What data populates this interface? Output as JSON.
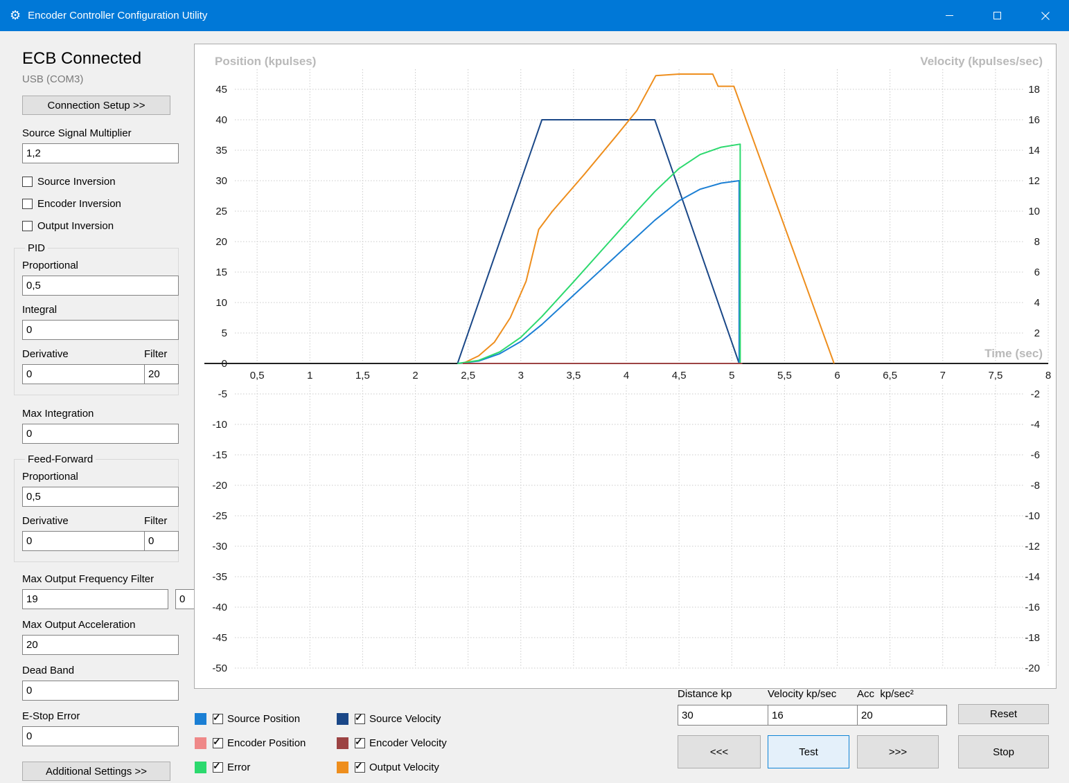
{
  "window": {
    "title": "Encoder Controller Configuration Utility"
  },
  "sidebar": {
    "status_heading": "ECB Connected",
    "port": "USB (COM3)",
    "connection_setup_label": "Connection Setup >>",
    "source_signal_multiplier": {
      "label": "Source Signal Multiplier",
      "value": "1,2"
    },
    "checkboxes": [
      {
        "label": "Source Inversion",
        "checked": false
      },
      {
        "label": "Encoder Inversion",
        "checked": false
      },
      {
        "label": "Output Inversion",
        "checked": false
      }
    ],
    "pid": {
      "group_label": "PID",
      "proportional_label": "Proportional",
      "proportional_value": "0,5",
      "integral_label": "Integral",
      "integral_value": "0",
      "derivative_label": "Derivative",
      "derivative_value": "0",
      "filter_label": "Filter",
      "filter_value": "20"
    },
    "max_integration": {
      "label": "Max Integration",
      "value": "0"
    },
    "feed_forward": {
      "group_label": "Feed-Forward",
      "proportional_label": "Proportional",
      "proportional_value": "0,5",
      "derivative_label": "Derivative",
      "derivative_value": "0",
      "filter_label": "Filter",
      "filter_value": "0"
    },
    "max_output_frequency_filter": {
      "label": "Max Output Frequency Filter",
      "value": "19",
      "aux_value": "0"
    },
    "max_output_acceleration": {
      "label": "Max Output Acceleration",
      "value": "20"
    },
    "dead_band": {
      "label": "Dead Band",
      "value": "0"
    },
    "e_stop_error": {
      "label": "E-Stop Error",
      "value": "0"
    },
    "additional_settings_label": "Additional Settings >>"
  },
  "chart_data": {
    "type": "line",
    "grid": true,
    "x_axis": {
      "label": "Time (sec)",
      "min": 0,
      "max": 8,
      "tick_step": 0.5
    },
    "left_axis": {
      "label": "Position (kpulses)",
      "min": -50,
      "max": 45,
      "tick_step": 5
    },
    "right_axis": {
      "label": "Velocity (kpulses/sec)",
      "min": -20,
      "max": 18,
      "tick_step": 2
    },
    "series": [
      {
        "name": "Encoder Position",
        "axis": "left",
        "color": "#ef8888",
        "points": [
          [
            2.4,
            0
          ],
          [
            5.1,
            0
          ]
        ]
      },
      {
        "name": "Source Velocity",
        "axis": "right",
        "color": "#1a4787",
        "points": [
          [
            2.4,
            0
          ],
          [
            3.2,
            16
          ],
          [
            4.27,
            16
          ],
          [
            5.07,
            0
          ]
        ]
      },
      {
        "name": "Output Velocity",
        "axis": "right",
        "color": "#ee8e1d",
        "points": [
          [
            2.45,
            0
          ],
          [
            2.6,
            0.5
          ],
          [
            2.75,
            1.4
          ],
          [
            2.9,
            3.0
          ],
          [
            3.05,
            5.4
          ],
          [
            3.17,
            8.8
          ],
          [
            3.3,
            10.0
          ],
          [
            3.6,
            12.4
          ],
          [
            3.9,
            14.9
          ],
          [
            4.1,
            16.6
          ],
          [
            4.28,
            18.9
          ],
          [
            4.5,
            19
          ],
          [
            4.82,
            19
          ],
          [
            4.87,
            18.2
          ],
          [
            5.02,
            18.2
          ],
          [
            5.97,
            0
          ]
        ]
      },
      {
        "name": "Source Position",
        "axis": "left",
        "color": "#1b7fd4",
        "points": [
          [
            2.4,
            0
          ],
          [
            2.6,
            0.4
          ],
          [
            2.8,
            1.6
          ],
          [
            3.0,
            3.6
          ],
          [
            3.2,
            6.4
          ],
          [
            3.5,
            11.2
          ],
          [
            3.8,
            16
          ],
          [
            4.1,
            20.8
          ],
          [
            4.27,
            23.5
          ],
          [
            4.5,
            26.7
          ],
          [
            4.7,
            28.6
          ],
          [
            4.9,
            29.6
          ],
          [
            5.07,
            30
          ],
          [
            5.07,
            0
          ]
        ]
      },
      {
        "name": "Error",
        "axis": "left",
        "color": "#2cd96e",
        "points": [
          [
            2.4,
            0
          ],
          [
            2.6,
            0.5
          ],
          [
            2.8,
            1.9
          ],
          [
            3.0,
            4.3
          ],
          [
            3.2,
            7.7
          ],
          [
            3.5,
            13.4
          ],
          [
            3.8,
            19.2
          ],
          [
            4.1,
            25.0
          ],
          [
            4.27,
            28.2
          ],
          [
            4.5,
            32.0
          ],
          [
            4.7,
            34.3
          ],
          [
            4.9,
            35.5
          ],
          [
            5.08,
            36
          ],
          [
            5.08,
            0
          ]
        ]
      },
      {
        "name": "Encoder Velocity",
        "axis": "right",
        "color": "#9c4343",
        "points": [
          [
            2.45,
            0
          ],
          [
            5.1,
            0
          ]
        ]
      }
    ]
  },
  "legend": {
    "items": [
      {
        "label": "Source Position",
        "color": "#1b7fd4",
        "checked": true
      },
      {
        "label": "Encoder Position",
        "color": "#ef8888",
        "checked": true
      },
      {
        "label": "Error",
        "color": "#2cd96e",
        "checked": true
      },
      {
        "label": "Source Velocity",
        "color": "#1a4787",
        "checked": true
      },
      {
        "label": "Encoder Velocity",
        "color": "#9c4343",
        "checked": true
      },
      {
        "label": "Output Velocity",
        "color": "#ee8e1d",
        "checked": true
      }
    ]
  },
  "test_panel": {
    "distance_label": "Distance kp",
    "distance_value": "30",
    "velocity_label": "Velocity kp/sec",
    "velocity_value": "16",
    "acc_label": "Acc  kp/sec²",
    "acc_value": "20",
    "reset_label": "Reset",
    "back_label": "<<<",
    "test_label": "Test",
    "forward_label": ">>>",
    "stop_label": "Stop"
  }
}
